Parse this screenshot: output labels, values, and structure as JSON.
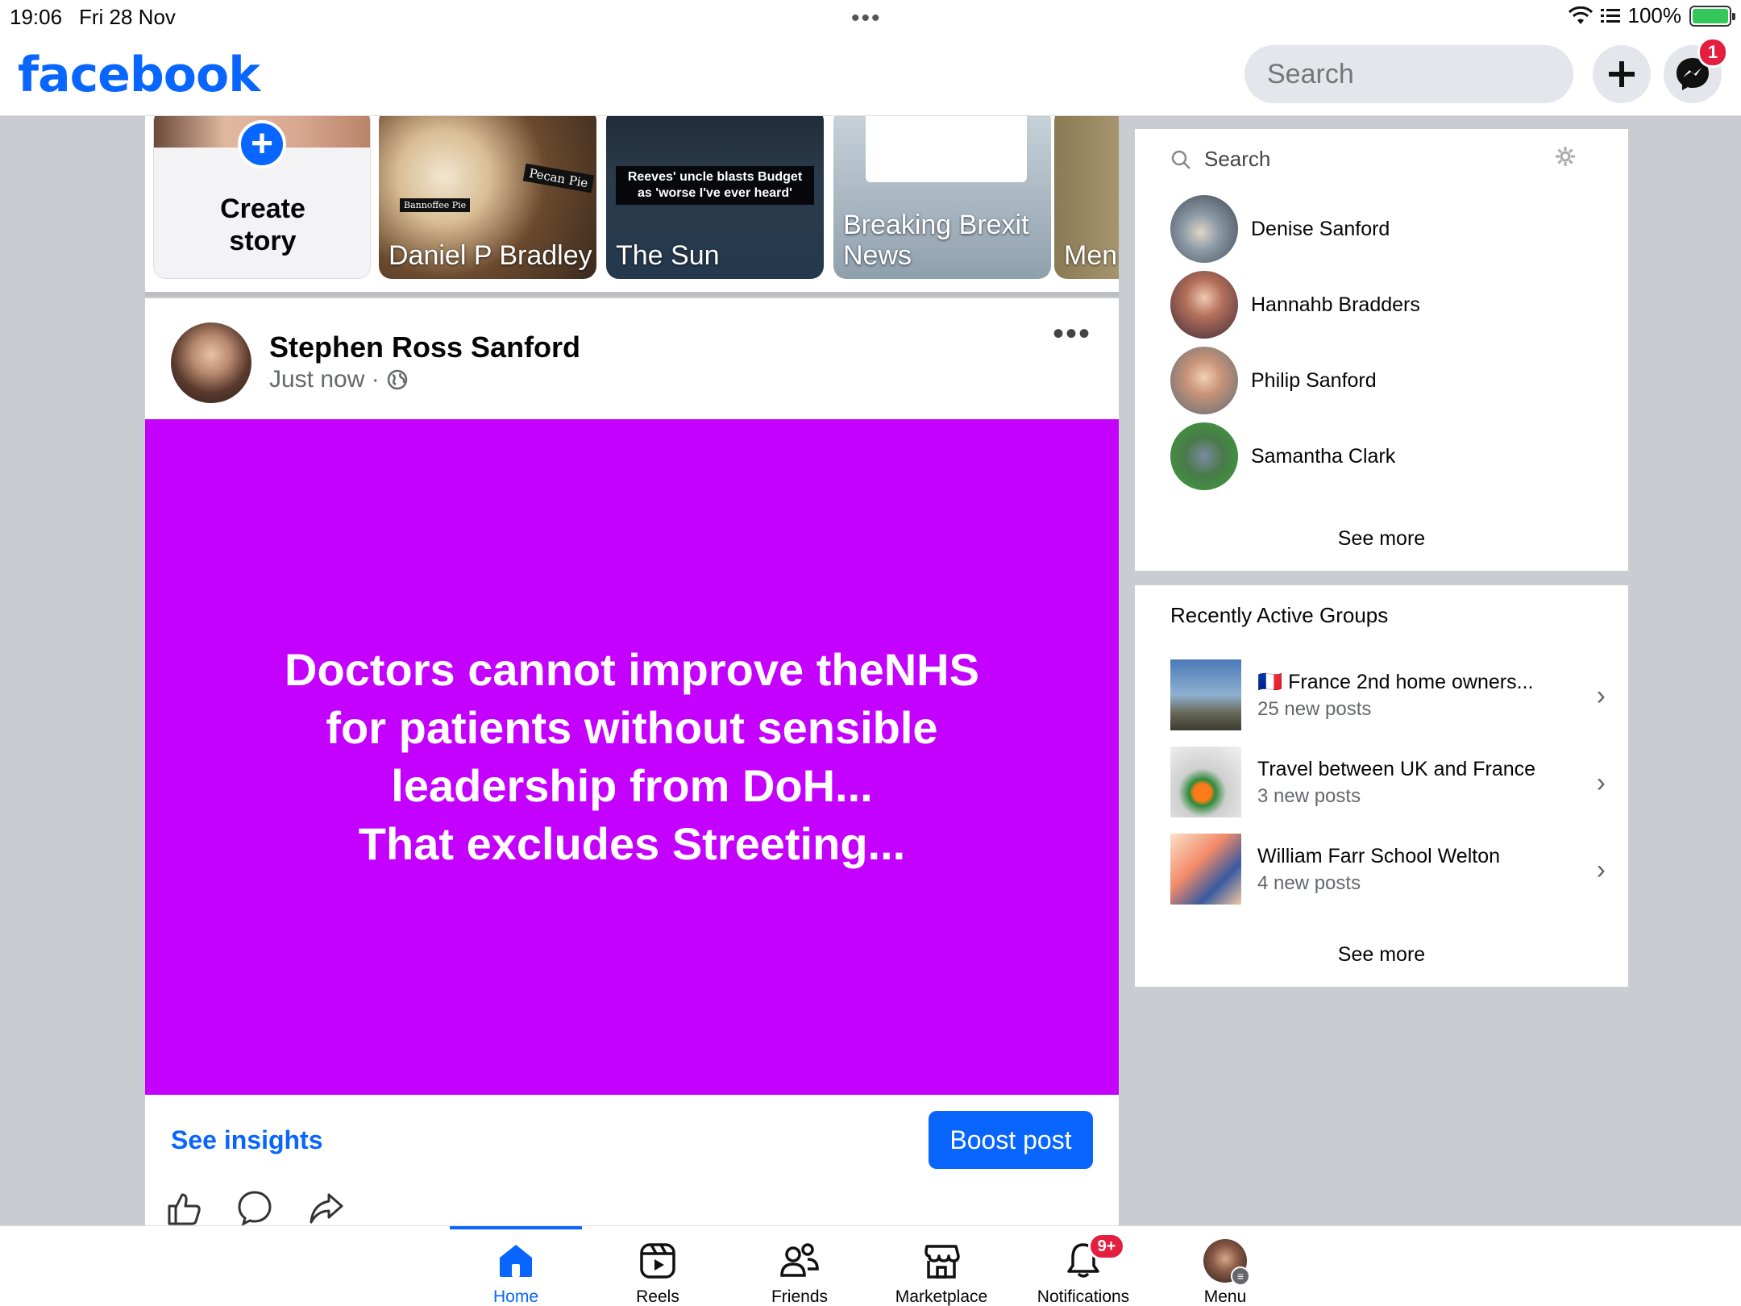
{
  "status_bar": {
    "time": "19:06",
    "date": "Fri 28 Nov",
    "battery": "100%",
    "multitask": "•••"
  },
  "header": {
    "logo": "facebook",
    "search_placeholder": "Search",
    "messenger_badge": "1",
    "accent": "#0866ff"
  },
  "stories": [
    {
      "label": "Create\nstory",
      "kind": "create"
    },
    {
      "label": "Daniel P Bradley",
      "caption_a": "Pecan Pie",
      "caption_b": "Bannoffee Pie"
    },
    {
      "label": "The Sun",
      "caption": "Reeves' uncle blasts Budget as 'worse I've ever heard'"
    },
    {
      "label": "Breaking Brexit News"
    },
    {
      "label": "Men"
    }
  ],
  "post": {
    "author": "Stephen Ross Sanford",
    "time": "Just now ·",
    "privacy_icon": "globe-icon",
    "text": "Doctors cannot improve theNHS\nfor patients without sensible\nleadership from DoH...\nThat excludes Streeting...",
    "background": "#c400ff",
    "insights_label": "See insights",
    "boost_label": "Boost post"
  },
  "contacts": {
    "search_placeholder": "Search",
    "items": [
      {
        "name": "Denise Sanford"
      },
      {
        "name": "Hannahb Bradders"
      },
      {
        "name": "Philip Sanford"
      },
      {
        "name": "Samantha Clark"
      }
    ],
    "see_more": "See more"
  },
  "groups": {
    "title": "Recently Active Groups",
    "items": [
      {
        "flag": "🇫🇷",
        "name": "France 2nd home owners...",
        "posts": "25 new posts"
      },
      {
        "name": "Travel between UK and France",
        "posts": "3 new posts"
      },
      {
        "name": "William Farr School Welton",
        "posts": "4 new posts"
      }
    ],
    "see_more": "See more"
  },
  "tabs": [
    {
      "label": "Home",
      "active": true
    },
    {
      "label": "Reels"
    },
    {
      "label": "Friends"
    },
    {
      "label": "Marketplace"
    },
    {
      "label": "Notifications",
      "badge": "9+"
    },
    {
      "label": "Menu"
    }
  ]
}
